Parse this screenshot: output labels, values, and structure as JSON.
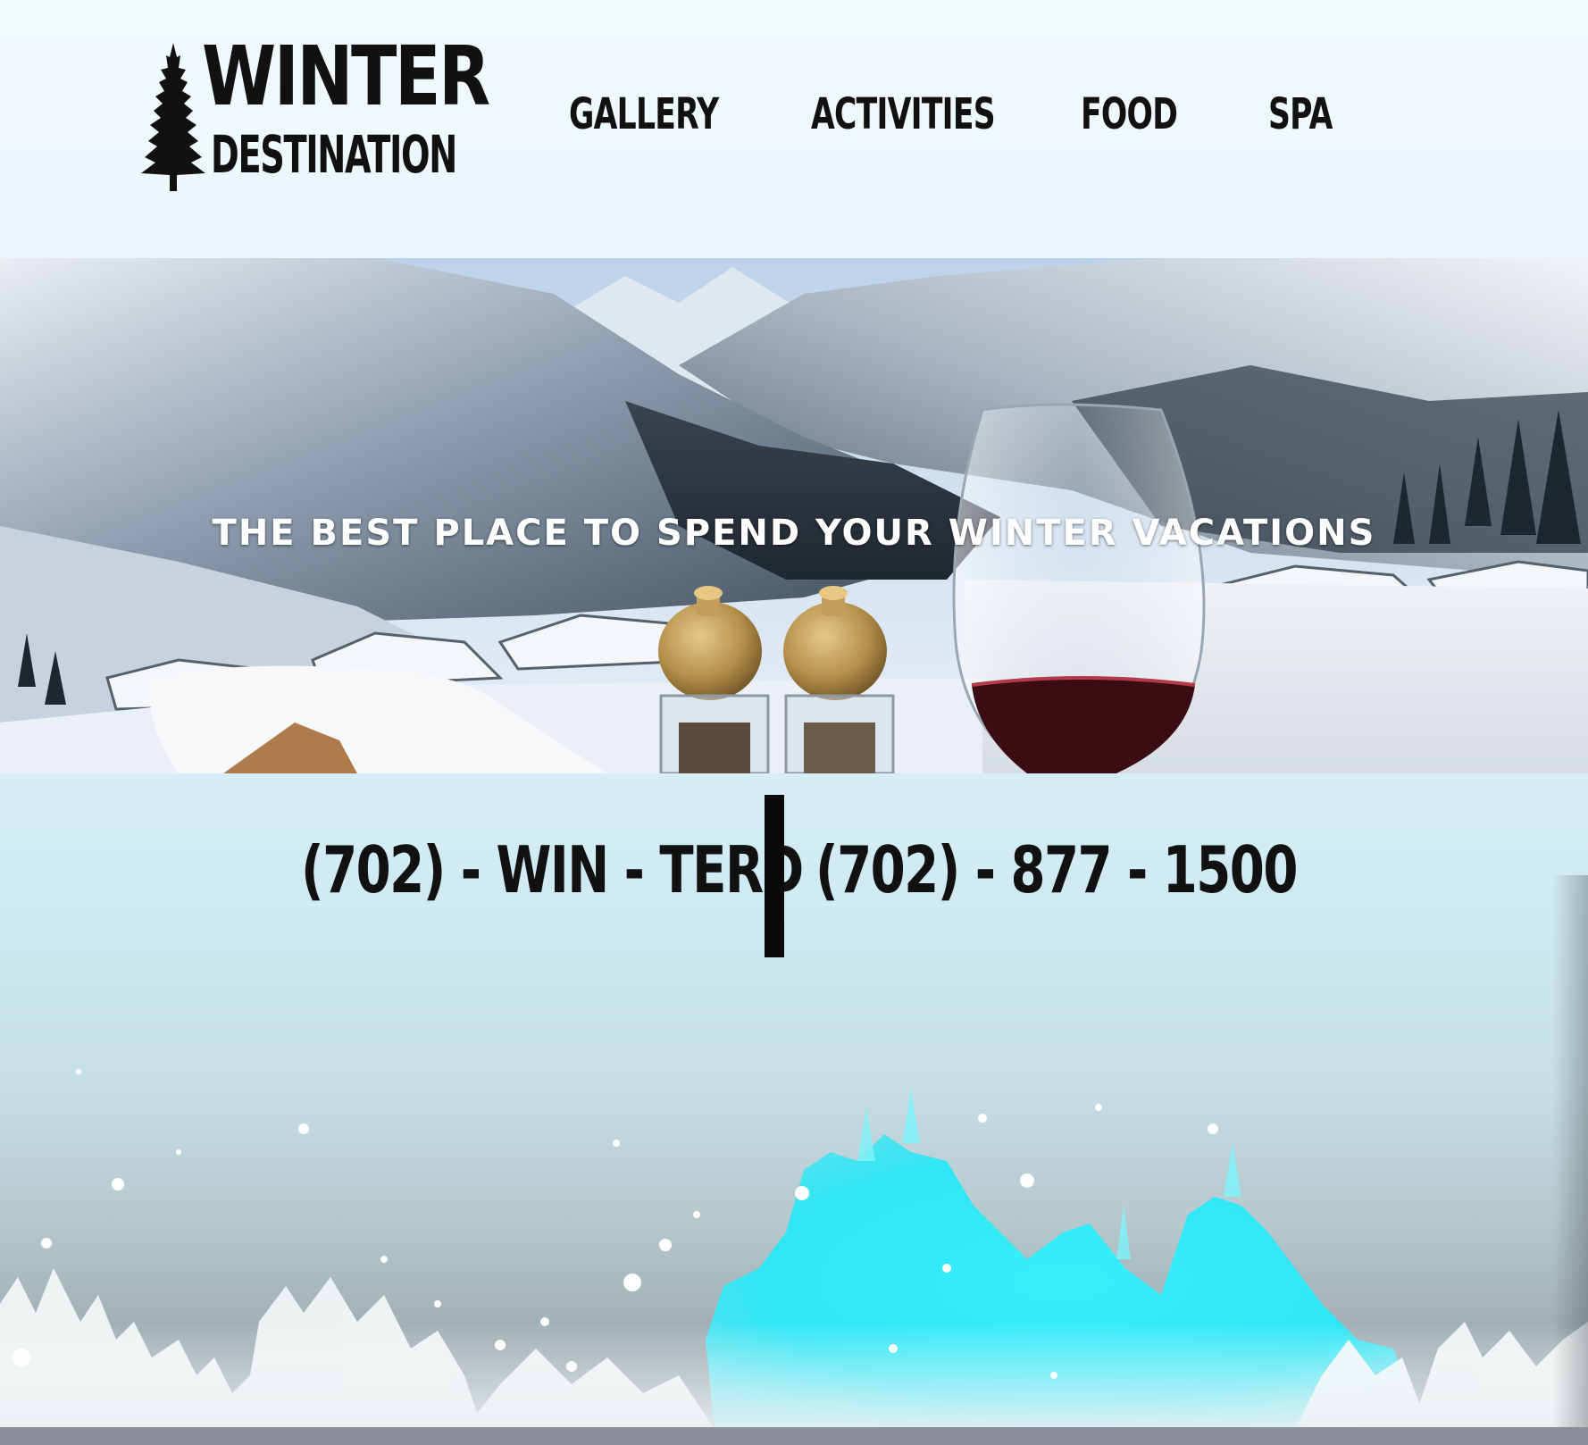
{
  "logo": {
    "line1": "WINTER",
    "line2": "DESTINATION",
    "icon": "pine-tree-icon"
  },
  "nav": {
    "items": [
      {
        "label": "GALLERY"
      },
      {
        "label": "ACTIVITIES"
      },
      {
        "label": "FOOD"
      },
      {
        "label": "SPA"
      }
    ]
  },
  "hero": {
    "tagline": "THE BEST PLACE TO SPEND YOUR WINTER VACATIONS"
  },
  "contact": {
    "phone_vanity": "(702) - WIN - TERD",
    "phone_numeric": "(702) - 877 - 1500"
  },
  "colors": {
    "accent_cyan": "#2fe6f4",
    "text_dark": "#111111",
    "divider": "#0a0a0a",
    "background_light": "#e6f4fb"
  }
}
